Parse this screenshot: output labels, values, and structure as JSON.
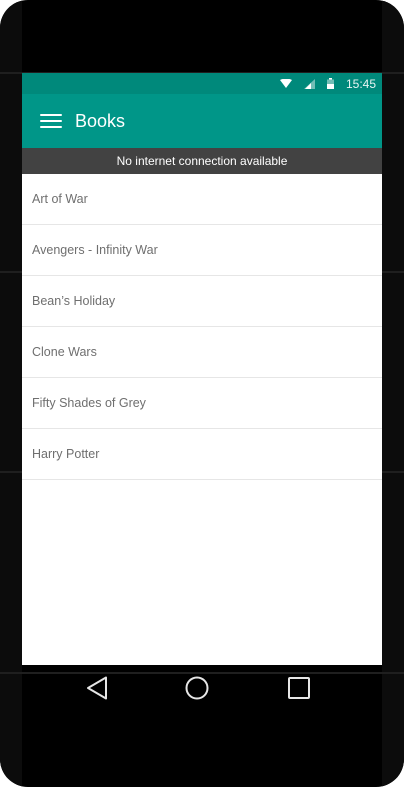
{
  "status_bar": {
    "time": "15:45",
    "icons": [
      "wifi-icon",
      "signal-icon",
      "battery-icon"
    ]
  },
  "app_bar": {
    "menu_icon": "menu-icon",
    "title": "Books"
  },
  "banner": {
    "text": "No internet connection available"
  },
  "books": [
    {
      "title": "Art of War"
    },
    {
      "title": "Avengers - Infinity War"
    },
    {
      "title": "Bean’s Holiday"
    },
    {
      "title": "Clone Wars"
    },
    {
      "title": "Fifty Shades of Grey"
    },
    {
      "title": "Harry Potter"
    }
  ],
  "nav_bar": {
    "icons": [
      "back-icon",
      "home-icon",
      "recents-icon"
    ]
  },
  "colors": {
    "primary": "#009688",
    "primary_dark": "#00897b",
    "banner": "#424242",
    "text": "#6f6f6f"
  }
}
